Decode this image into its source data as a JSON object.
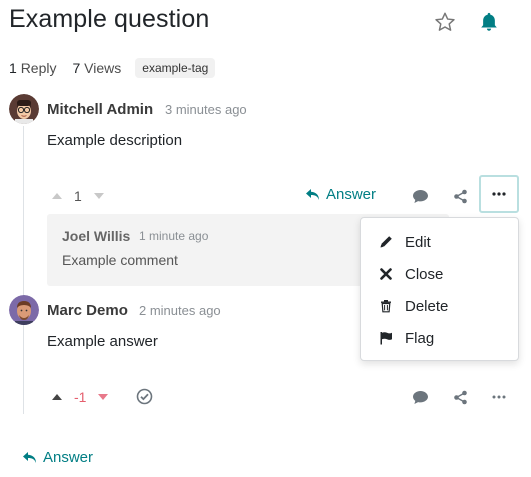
{
  "question": {
    "title": "Example question",
    "stats": {
      "replies_count": "1",
      "replies_label": "Reply",
      "views_count": "7",
      "views_label": "Views"
    },
    "tag": "example-tag",
    "author": "Mitchell Admin",
    "time": "3 minutes ago",
    "body": "Example description",
    "votes": "1",
    "answer_label": "Answer"
  },
  "comment": {
    "author": "Joel Willis",
    "time": "1 minute ago",
    "body": "Example comment"
  },
  "dropdown": {
    "items": [
      {
        "label": "Edit",
        "icon": "pencil-icon"
      },
      {
        "label": "Close",
        "icon": "close-icon"
      },
      {
        "label": "Delete",
        "icon": "trash-icon"
      },
      {
        "label": "Flag",
        "icon": "flag-icon"
      }
    ]
  },
  "answer": {
    "author": "Marc Demo",
    "time": "2 minutes ago",
    "body": "Example answer",
    "votes": "-1"
  },
  "footer": {
    "answer_label": "Answer"
  },
  "colors": {
    "accent": "#017e84",
    "negative": "#e55f6e",
    "comment_bg": "#f3f3f3"
  }
}
